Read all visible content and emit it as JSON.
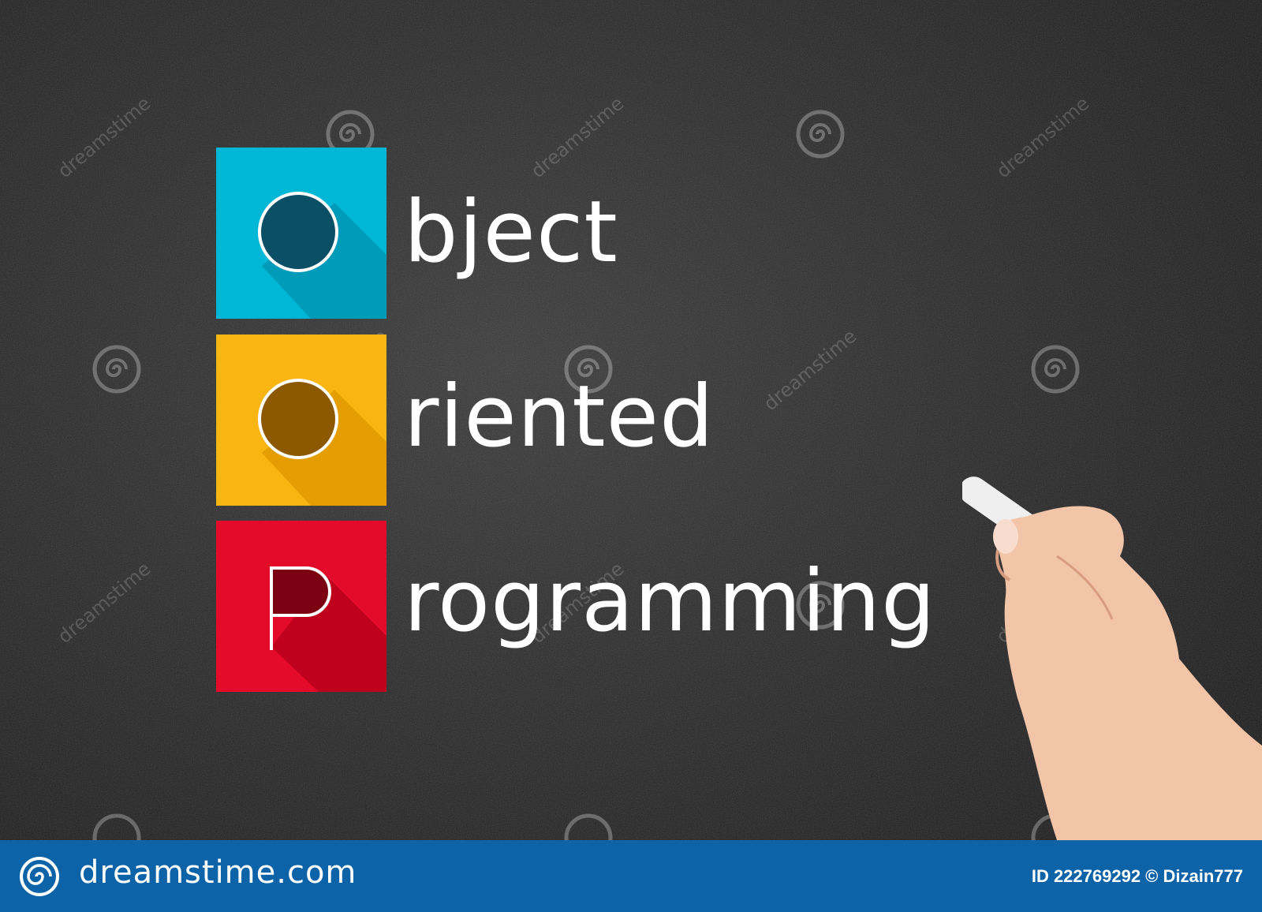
{
  "image": {
    "description_words": [
      "bject",
      "riented",
      "rogramming"
    ],
    "acronym_letters": [
      "O",
      "O",
      "P"
    ]
  },
  "tiles": [
    {
      "letter": "O",
      "color": "#00b7d6",
      "shadow": "#00809a",
      "inner": "#0b4f66"
    },
    {
      "letter": "O",
      "color": "#f9b612",
      "shadow": "#c98a00",
      "inner": "#8c5800"
    },
    {
      "letter": "P",
      "color": "#e30a2a",
      "shadow": "#a0001a",
      "inner": "#7a0012"
    }
  ],
  "words": [
    "bject",
    "riented",
    "rogramming"
  ],
  "watermark": {
    "text": "dreamstime",
    "footer_brand": "dreamstime.com",
    "footer_id": "ID 222769292 © Dizain777",
    "footer_color": "#0d63a8"
  }
}
